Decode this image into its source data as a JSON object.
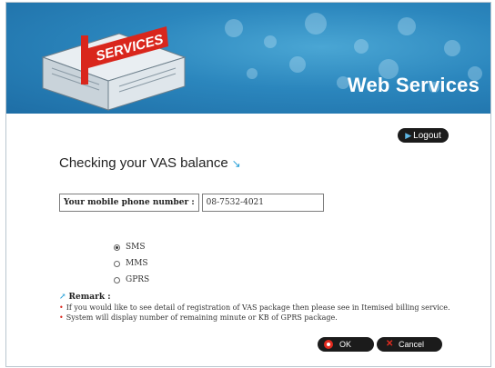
{
  "header": {
    "logo_text": "SERVICES",
    "title": "Web Services"
  },
  "toolbar": {
    "logout_label": "Logout"
  },
  "main": {
    "page_title": "Checking your VAS balance",
    "phone_label": "Your mobile phone number :",
    "phone_value": "08-7532-4021",
    "options": [
      "SMS",
      "MMS",
      "GPRS"
    ],
    "selected_option": "SMS",
    "remark_title": "Remark :",
    "remarks": [
      "If you would like to see detail of registration of VAS package then please see in Itemised billing service.",
      "System will display number of remaining minute or KB of GPRS package."
    ]
  },
  "actions": {
    "ok_label": "OK",
    "cancel_label": "Cancel"
  },
  "colors": {
    "header_blue": "#2b86bd",
    "button_dark": "#1b1b1b",
    "accent_red": "#e22b1f",
    "accent_blue": "#2aa1d8"
  }
}
